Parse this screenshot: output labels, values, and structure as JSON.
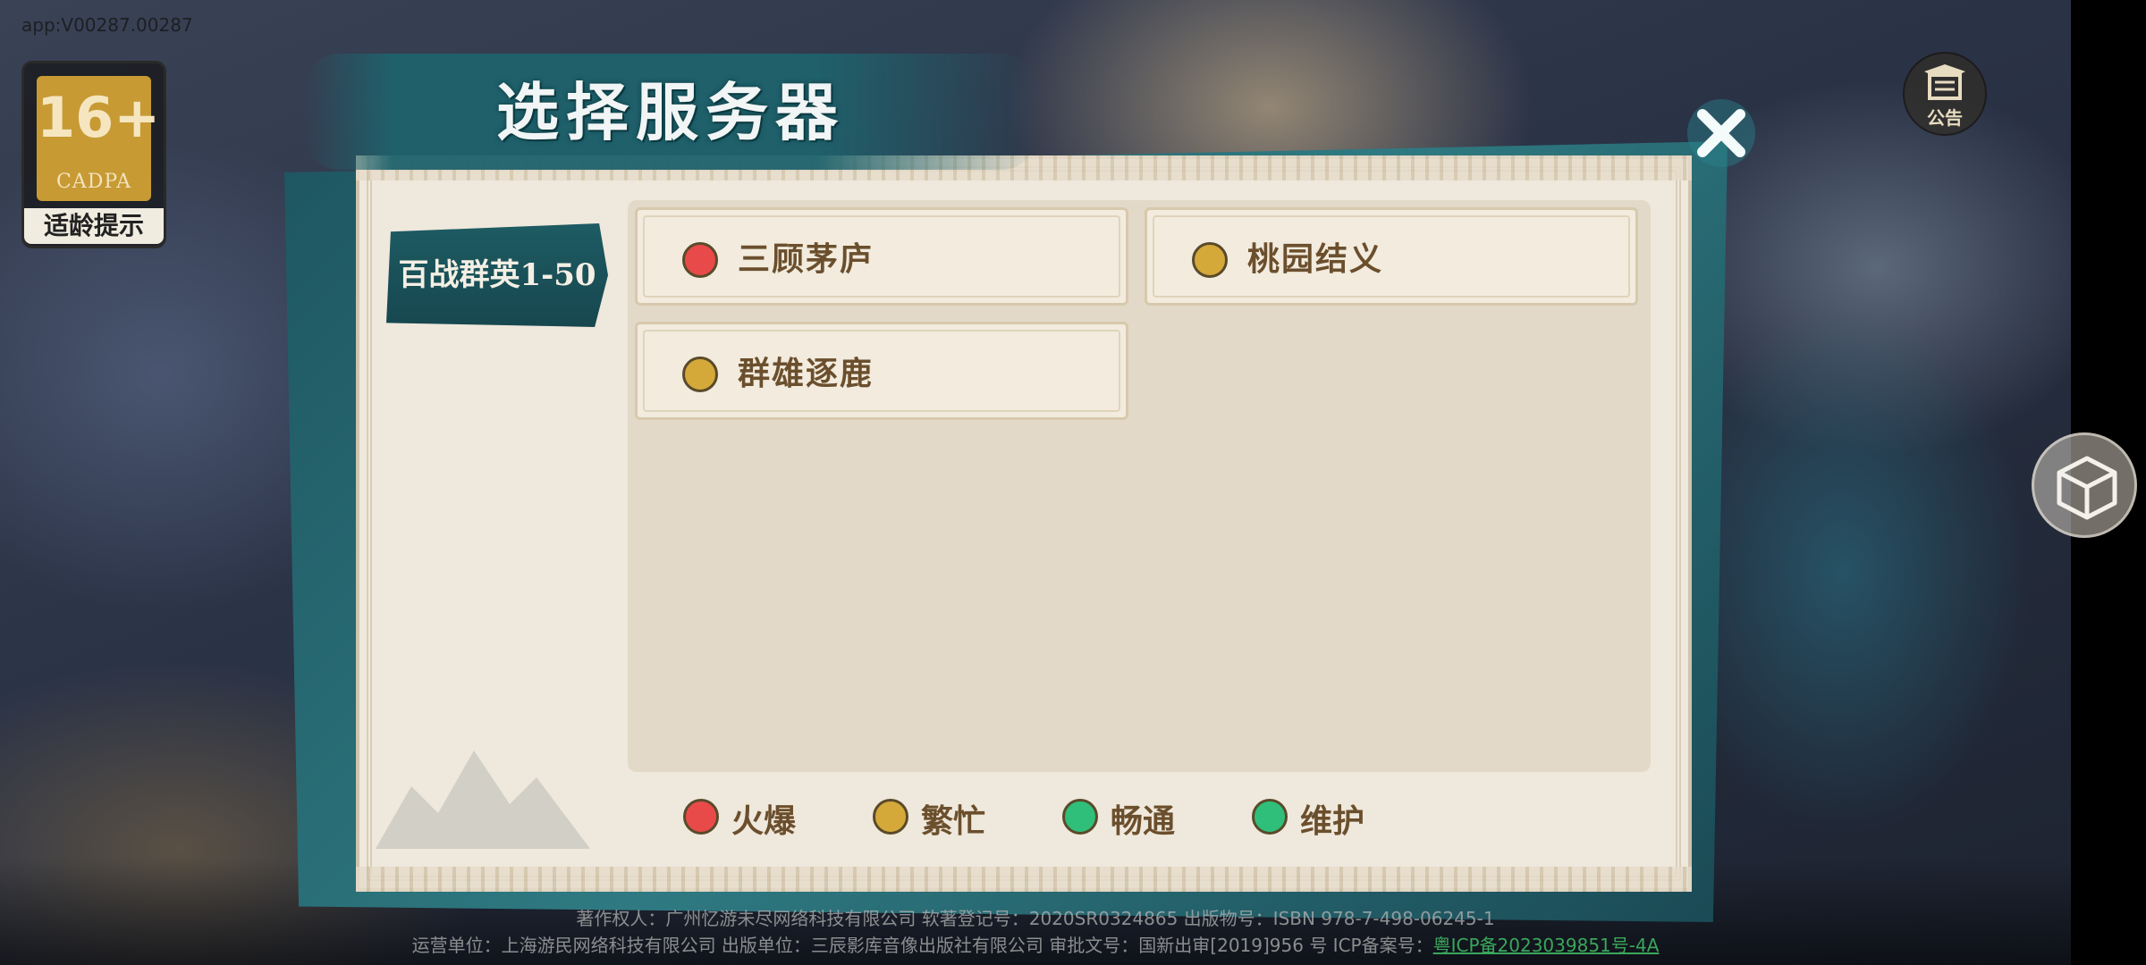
{
  "app": {
    "version": "app:V00287.00287"
  },
  "age_rating": {
    "age": "16+",
    "organization": "CADPA",
    "label": "适龄提示"
  },
  "notice": {
    "label": "公告",
    "icon": "notice-icon"
  },
  "dialog": {
    "title": "选择服务器",
    "close_icon": "close-icon",
    "tabs": [
      {
        "label": "百战群英1-50",
        "active": true
      }
    ],
    "servers": [
      {
        "name": "三顾茅庐",
        "status": "火爆",
        "status_color": "#e84a4a"
      },
      {
        "name": "桃园结义",
        "status": "繁忙",
        "status_color": "#d4a93a"
      },
      {
        "name": "群雄逐鹿",
        "status": "繁忙",
        "status_color": "#d4a93a"
      }
    ],
    "legend": [
      {
        "label": "火爆",
        "color": "#e84a4a"
      },
      {
        "label": "繁忙",
        "color": "#d4a93a"
      },
      {
        "label": "畅通",
        "color": "#2fbf7a"
      },
      {
        "label": "维护",
        "color": "#2fbf7a"
      }
    ]
  },
  "side_button": {
    "icon": "cube-icon"
  },
  "footer": {
    "line1": "著作权人：广州忆游未尽网络科技有限公司 软著登记号：2020SR0324865 出版物号：ISBN 978-7-498-06245-1",
    "line2_prefix": "运营单位：上海游民网络科技有限公司 出版单位：三辰影库音像出版社有限公司 审批文号：国新出审[2019]956 号 ICP备案号：",
    "icp_link": "粤ICP备2023039851号-4A"
  }
}
